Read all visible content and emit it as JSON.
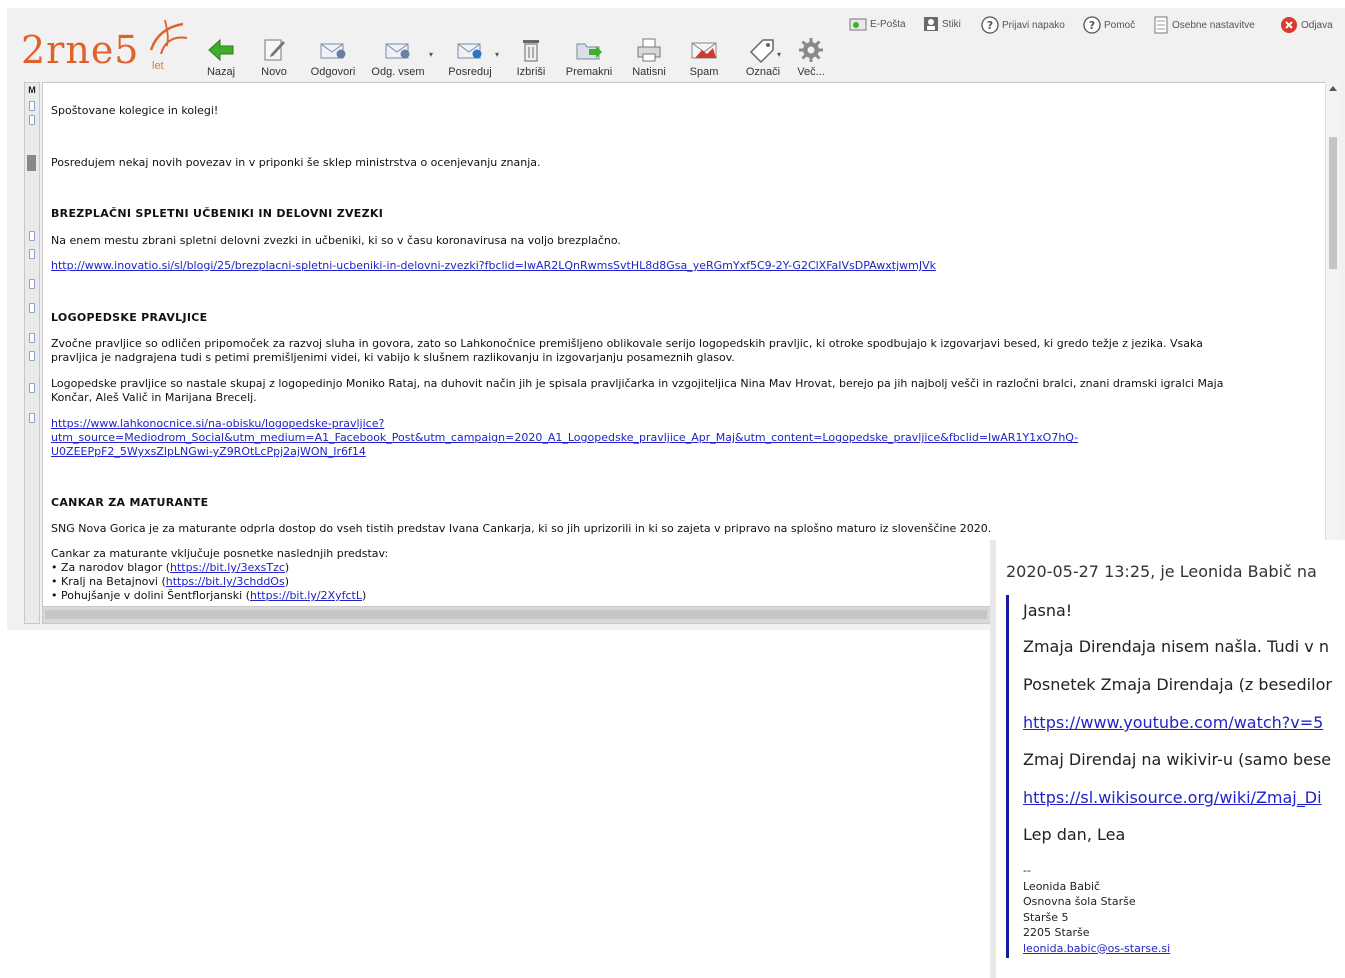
{
  "app": {
    "logo_text": "2rne5",
    "logo_suffix": "let"
  },
  "toolbar": {
    "back": "Nazaj",
    "new": "Novo",
    "reply": "Odgovori",
    "reply_all": "Odg. vsem",
    "forward": "Posreduj",
    "delete": "Izbriši",
    "move": "Premakni",
    "print": "Natisni",
    "spam": "Spam",
    "tag": "Označi",
    "more": "Več..."
  },
  "topnav": {
    "email": "E-Pošta",
    "contacts": "Stiki",
    "report_bug": "Prijavi napako",
    "help": "Pomoč",
    "settings": "Osebne nastavitve",
    "logout": "Odjava"
  },
  "left_strip": {
    "label": "M"
  },
  "message": {
    "greeting": "Spoštovane kolegice in kolegi!",
    "intro": "Posredujem nekaj novih povezav in v priponki še sklep ministrstva o ocenjevanju znanja.",
    "section1_title": "BREZPLAČNI SPLETNI UČBENIKI IN DELOVNI ZVEZKI",
    "section1_text": "Na enem mestu zbrani spletni delovni zvezki in učbeniki, ki so v času koronavirusa na voljo brezplačno.",
    "section1_link": "http://www.inovatio.si/sl/blogi/25/brezplacni-spletni-ucbeniki-in-delovni-zvezki?fbclid=IwAR2LQnRwmsSvtHL8d8Gsa_yeRGmYxf5C9-2Y-G2ClXFaIVsDPAwxtjwmJVk",
    "section2_title": "LOGOPEDSKE PRAVLJICE",
    "section2_text1a": "Zvočne pravljice so odličen pripomoček za razvoj sluha in govora, zato so Lahkonočnice premišljeno oblikovale serijo logopedskih pravljic, ki otroke spodbujajo k izgovarjavi besed, ki gredo težje z jezika. Vsaka",
    "section2_text1b": "pravljica je nadgrajena tudi s petimi premišljenimi videi, ki vabijo k slušnem razlikovanju in izgovarjanju posameznih glasov.",
    "section2_text2a": "Logopedske pravljice so nastale skupaj z logopedinjo Moniko Rataj, na duhovit način jih je spisala pravljičarka in vzgojiteljica Nina Mav Hrovat, berejo pa jih najbolj vešči in razločni bralci, znani dramski igralci Maja",
    "section2_text2b": "Končar, Aleš Valič in Marijana Brecelj.",
    "section2_link_l1": "https://www.lahkonocnice.si/na-obisku/logopedske-pravljice?",
    "section2_link_l2": "utm_source=Mediodrom_Social&utm_medium=A1_Facebook_Post&utm_campaign=2020_A1_Logopedske_pravljice_Apr_Maj&utm_content=Logopedske_pravljice&fbclid=IwAR1Y1xO7hQ-",
    "section2_link_l3": "U0ZEEPpF2_5WyxsZlpLNGwi-yZ9ROtLcPpj2ajWON_Ir6f14",
    "section3_title": "CANKAR ZA MATURANTE",
    "section3_text": "SNG Nova Gorica je za maturante odprla dostop do vseh tistih predstav Ivana Cankarja, ki so jih uprizorili in ki so zajeta v pripravo na splošno maturo iz slovenščine 2020.",
    "section3_list_intro": "Cankar za maturante vključuje posnetke naslednjih predstav:",
    "items": [
      {
        "prefix": "• Za narodov blagor (",
        "link": "https://bit.ly/3exsTzc",
        "suffix": ")"
      },
      {
        "prefix": "• Kralj na Betajnovi (",
        "link": "https://bit.ly/3chddOs",
        "suffix": ")"
      },
      {
        "prefix": "• Pohujšanje v dolini Šentflorjanski (",
        "link": "https://bit.ly/2XyfctL",
        "suffix": ")"
      }
    ]
  },
  "overlay": {
    "header": "2020-05-27 13:25, je Leonida Babič na",
    "l1": "Jasna!",
    "l2": "Zmaja Direndaja nisem našla. Tudi v n",
    "l3": "Posnetek Zmaja Direndaja (z besedilor",
    "l4_link": "https://www.youtube.com/watch?v=5",
    "l5": "Zmaj Direndaj na wikivir-u (samo bese",
    "l6_link": "https://sl.wikisource.org/wiki/Zmaj_Di",
    "l7": "Lep dan, Lea",
    "sig_sep": "--",
    "sig_name": "Leonida Babič",
    "sig_school": "Osnovna šola Starše",
    "sig_street": "Starše 5",
    "sig_city": "2205 Starše",
    "sig_mail": "leonida.babic@os-starse.si"
  }
}
